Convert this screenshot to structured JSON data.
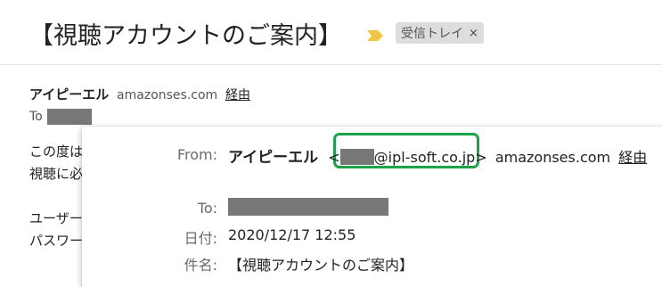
{
  "email": {
    "subject": "【視聴アカウントのご案内】",
    "label": "受信トレイ",
    "label_remove": "×",
    "sender_name": "アイピーエル",
    "sender_domain": "amazonses.com",
    "via": "経由",
    "to_label": "To",
    "body_lines": [
      "この度は",
      "視聴に必",
      "",
      "ユーザー",
      "パスワー"
    ]
  },
  "details_popup": {
    "from_label": "From:",
    "from_name": "アイピーエル",
    "from_address_suffix": "@ipl-soft.co.jp",
    "from_lt": "<",
    "from_gt": ">",
    "from_domain": "amazonses.com",
    "via": "経由",
    "to_label": "To:",
    "date_label": "日付:",
    "date_value": "2020/12/17 12:55",
    "subject_label": "件名:",
    "subject_value": "【視聴アカウントのご案内】"
  },
  "icons": {
    "importance": "importance-marker-icon",
    "close": "close-icon"
  },
  "colors": {
    "importance": "#f4c542",
    "highlight": "#1aa34a",
    "redaction": "#777777"
  }
}
